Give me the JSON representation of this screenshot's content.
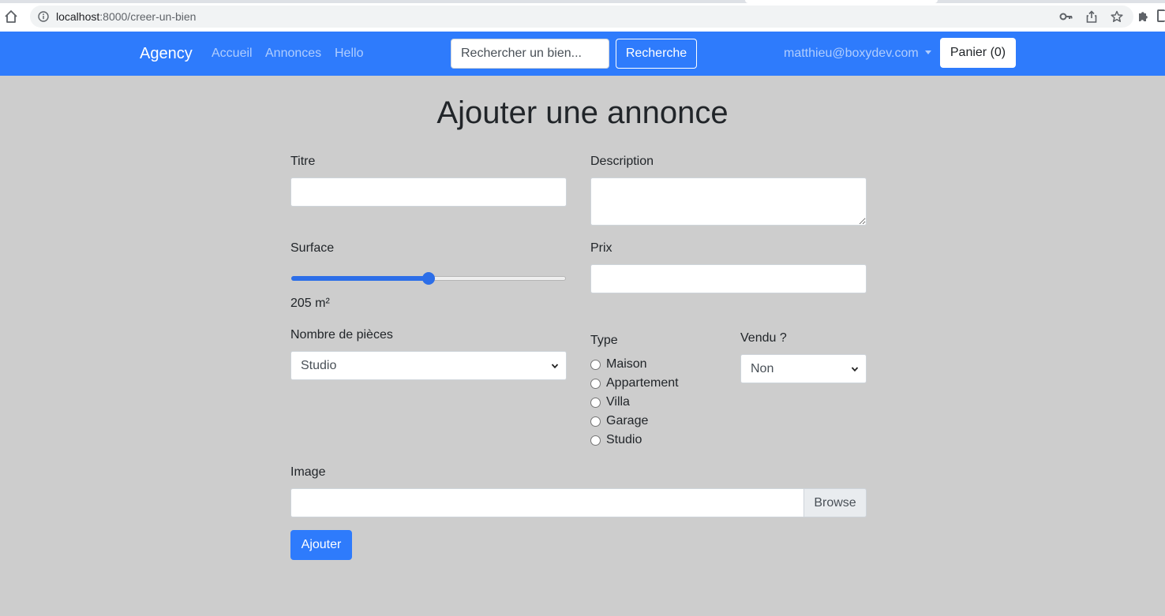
{
  "browser": {
    "url_host": "localhost",
    "url_path": ":8000/creer-un-bien"
  },
  "navbar": {
    "brand": "Agency",
    "links": [
      "Accueil",
      "Annonces",
      "Hello"
    ],
    "search_placeholder": "Rechercher un bien...",
    "search_button": "Recherche",
    "user_email": "matthieu@boxydev.com",
    "cart_button": "Panier (0)"
  },
  "form": {
    "title": "Ajouter une annonce",
    "titre_label": "Titre",
    "titre_value": "",
    "description_label": "Description",
    "description_value": "",
    "surface_label": "Surface",
    "surface_value_text": "205 m²",
    "surface_fraction": 0.5,
    "prix_label": "Prix",
    "prix_value": "",
    "pieces_label": "Nombre de pièces",
    "pieces_selected": "Studio",
    "type_label": "Type",
    "type_options": [
      "Maison",
      "Appartement",
      "Villa",
      "Garage",
      "Studio"
    ],
    "vendu_label": "Vendu ?",
    "vendu_selected": "Non",
    "image_label": "Image",
    "browse_button": "Browse",
    "submit_button": "Ajouter"
  },
  "colors": {
    "primary": "#2e7bfc",
    "page_background": "#cdcdcd"
  }
}
